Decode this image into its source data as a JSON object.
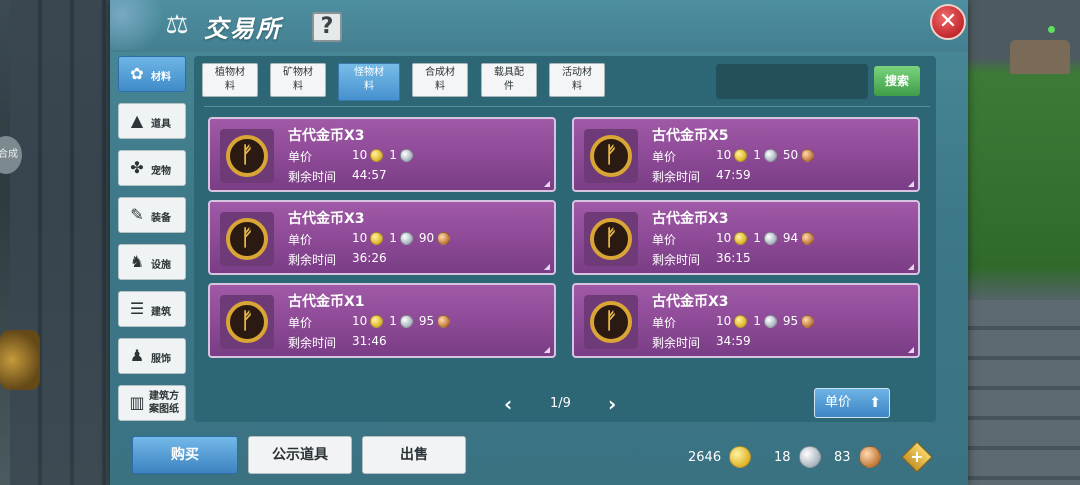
{
  "header": {
    "title": "交易所",
    "help_label": "?",
    "close_label": "✕"
  },
  "categories": [
    {
      "label": "材料",
      "icon": "materials-icon",
      "glyph": "✿",
      "active": true
    },
    {
      "label": "道具",
      "icon": "potion-icon",
      "glyph": "▲",
      "active": false
    },
    {
      "label": "宠物",
      "icon": "paw-icon",
      "glyph": "✤",
      "active": false
    },
    {
      "label": "装备",
      "icon": "equipment-icon",
      "glyph": "✎",
      "active": false
    },
    {
      "label": "设施",
      "icon": "facility-icon",
      "glyph": "♞",
      "active": false
    },
    {
      "label": "建筑",
      "icon": "building-icon",
      "glyph": "☰",
      "active": false
    },
    {
      "label": "服饰",
      "icon": "clothing-icon",
      "glyph": "♟",
      "active": false
    },
    {
      "label_line1": "建筑方",
      "label_line2": "案图纸",
      "icon": "blueprint-icon",
      "glyph": "▥",
      "active": false
    }
  ],
  "subtabs": [
    {
      "line1": "植物材",
      "line2": "料",
      "active": false
    },
    {
      "line1": "矿物材",
      "line2": "料",
      "active": false
    },
    {
      "line1": "怪物材",
      "line2": "料",
      "active": true
    },
    {
      "line1": "合成材",
      "line2": "料",
      "active": false
    },
    {
      "line1": "载具配",
      "line2": "件",
      "active": false
    },
    {
      "line1": "活动材",
      "line2": "料",
      "active": false
    }
  ],
  "search": {
    "value": "",
    "button_label": "搜索"
  },
  "listing_labels": {
    "price": "单价",
    "time": "剩余时间"
  },
  "listings": [
    {
      "name": "古代金币X3",
      "gold": "10",
      "silver": "1",
      "copper": "",
      "time": "44:57"
    },
    {
      "name": "古代金币X5",
      "gold": "10",
      "silver": "1",
      "copper": "50",
      "time": "47:59"
    },
    {
      "name": "古代金币X3",
      "gold": "10",
      "silver": "1",
      "copper": "90",
      "time": "36:26"
    },
    {
      "name": "古代金币X3",
      "gold": "10",
      "silver": "1",
      "copper": "94",
      "time": "36:15"
    },
    {
      "name": "古代金币X1",
      "gold": "10",
      "silver": "1",
      "copper": "95",
      "time": "31:46"
    },
    {
      "name": "古代金币X3",
      "gold": "10",
      "silver": "1",
      "copper": "95",
      "time": "34:59"
    }
  ],
  "pager": {
    "prev": "‹",
    "current": "1/9",
    "next": "›"
  },
  "sort": {
    "label": "单价"
  },
  "footer": {
    "buy": "购买",
    "public": "公示道具",
    "sell": "出售"
  },
  "wallet": {
    "gold": "2646",
    "silver": "18",
    "copper": "83"
  },
  "side_badge": "合成",
  "colors": {
    "card": "#8c4995",
    "accent": "#3f8bc9",
    "panel": "#3d7888"
  }
}
